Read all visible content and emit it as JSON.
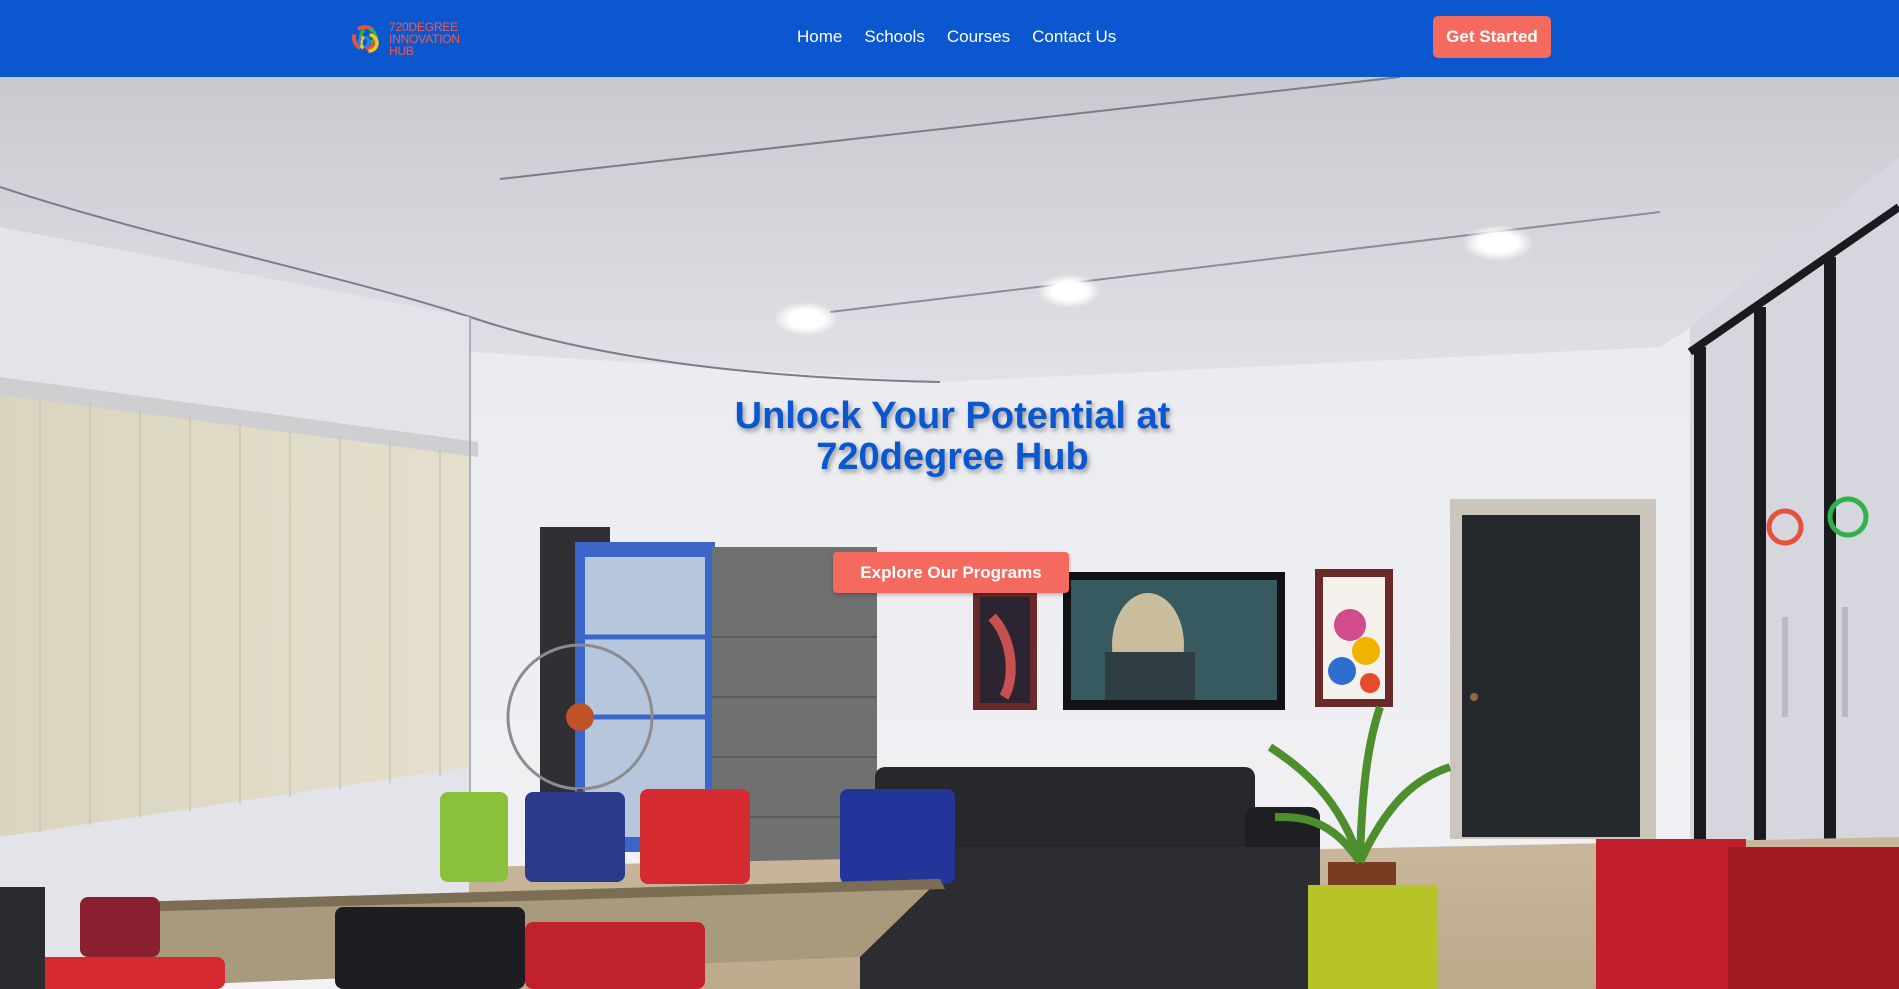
{
  "brand": {
    "name_lines": [
      "720degree",
      "innovation",
      "hub"
    ],
    "colors": {
      "primary": "#0a57cf",
      "accent": "#f46a5e"
    }
  },
  "nav": {
    "links": [
      {
        "label": "Home"
      },
      {
        "label": "Schools"
      },
      {
        "label": "Courses"
      },
      {
        "label": "Contact Us"
      }
    ],
    "cta_label": "Get Started"
  },
  "hero": {
    "title_lines": [
      "Unlock Your Potential at",
      "720degree Hub"
    ],
    "cta_label": "Explore Our Programs",
    "background": "photo of hub interior"
  }
}
